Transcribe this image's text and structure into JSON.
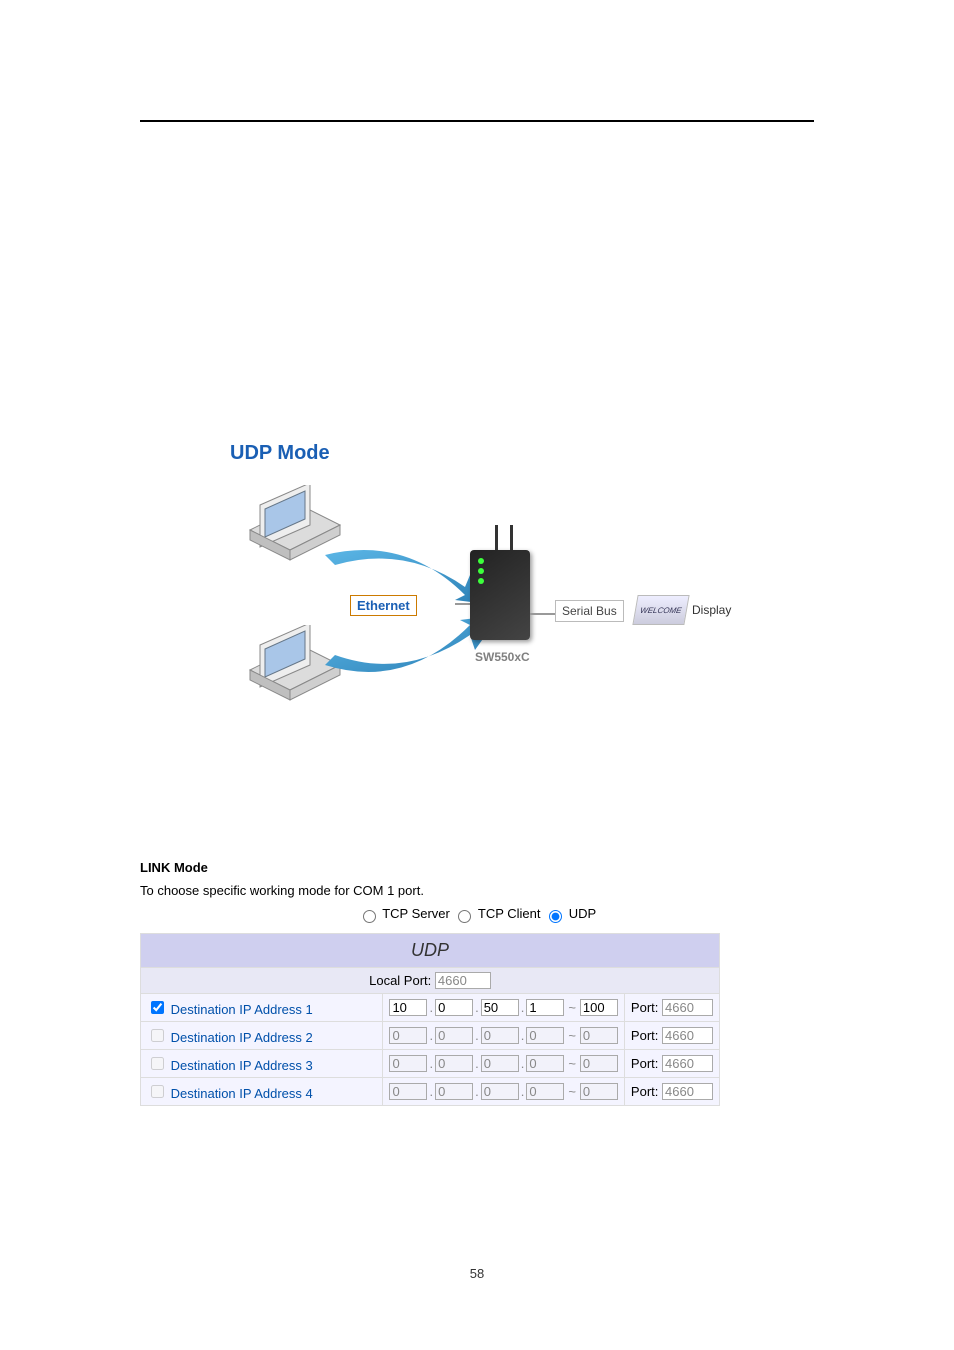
{
  "page_number": "58",
  "title": "UDP Mode",
  "diagram": {
    "ethernet_label": "Ethernet",
    "device_label": "SW550xC",
    "serial_bus_label": "Serial Bus",
    "welcome_label": "WELCOME",
    "display_label": "Display"
  },
  "link_mode": {
    "heading": "LINK Mode",
    "subtext": "To choose specific working mode for COM 1 port.",
    "radios": {
      "tcp_server": "TCP Server",
      "tcp_client": "TCP Client",
      "udp": "UDP"
    }
  },
  "udp_table": {
    "header": "UDP",
    "local_port_label": "Local Port:",
    "local_port_value": "4660",
    "port_label": "Port:",
    "rows": [
      {
        "enabled": true,
        "label": "Destination IP Address 1",
        "oct": [
          "10",
          "0",
          "50",
          "1"
        ],
        "range": "100",
        "port": "4660"
      },
      {
        "enabled": false,
        "label": "Destination IP Address 2",
        "oct": [
          "0",
          "0",
          "0",
          "0"
        ],
        "range": "0",
        "port": "4660"
      },
      {
        "enabled": false,
        "label": "Destination IP Address 3",
        "oct": [
          "0",
          "0",
          "0",
          "0"
        ],
        "range": "0",
        "port": "4660"
      },
      {
        "enabled": false,
        "label": "Destination IP Address 4",
        "oct": [
          "0",
          "0",
          "0",
          "0"
        ],
        "range": "0",
        "port": "4660"
      }
    ]
  }
}
